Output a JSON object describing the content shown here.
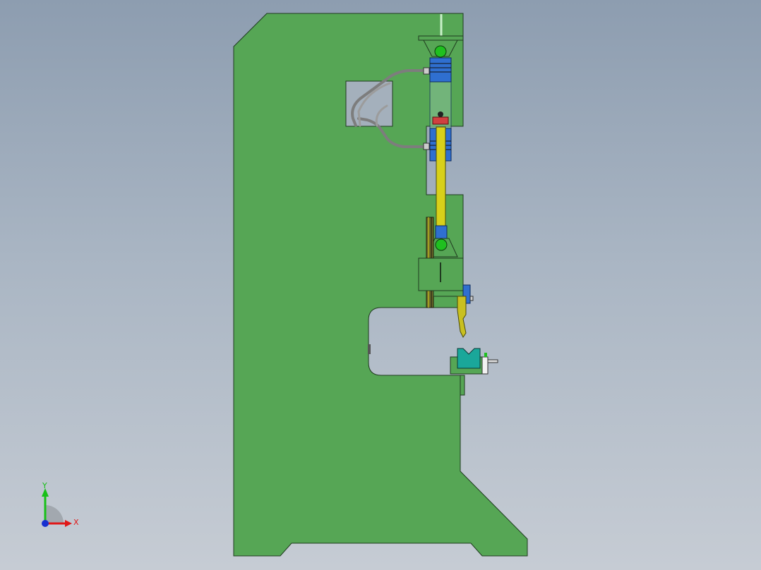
{
  "viewport": {
    "background_top": "#8d9db0",
    "background_bottom": "#c6ccd4"
  },
  "model": {
    "frame_color": "#56a655",
    "outline_color": "#1f3a1f",
    "cylinder_color": "#2f6fd0",
    "rod_color": "#d8d01a",
    "pivot_color": "#1fc01f",
    "die_color": "#1aa79a",
    "hose_color": "#9a9a9a"
  },
  "triad": {
    "x_label": "X",
    "y_label": "Y",
    "x_color": "#e01818",
    "y_color": "#18c018",
    "z_color": "#1830d0"
  }
}
